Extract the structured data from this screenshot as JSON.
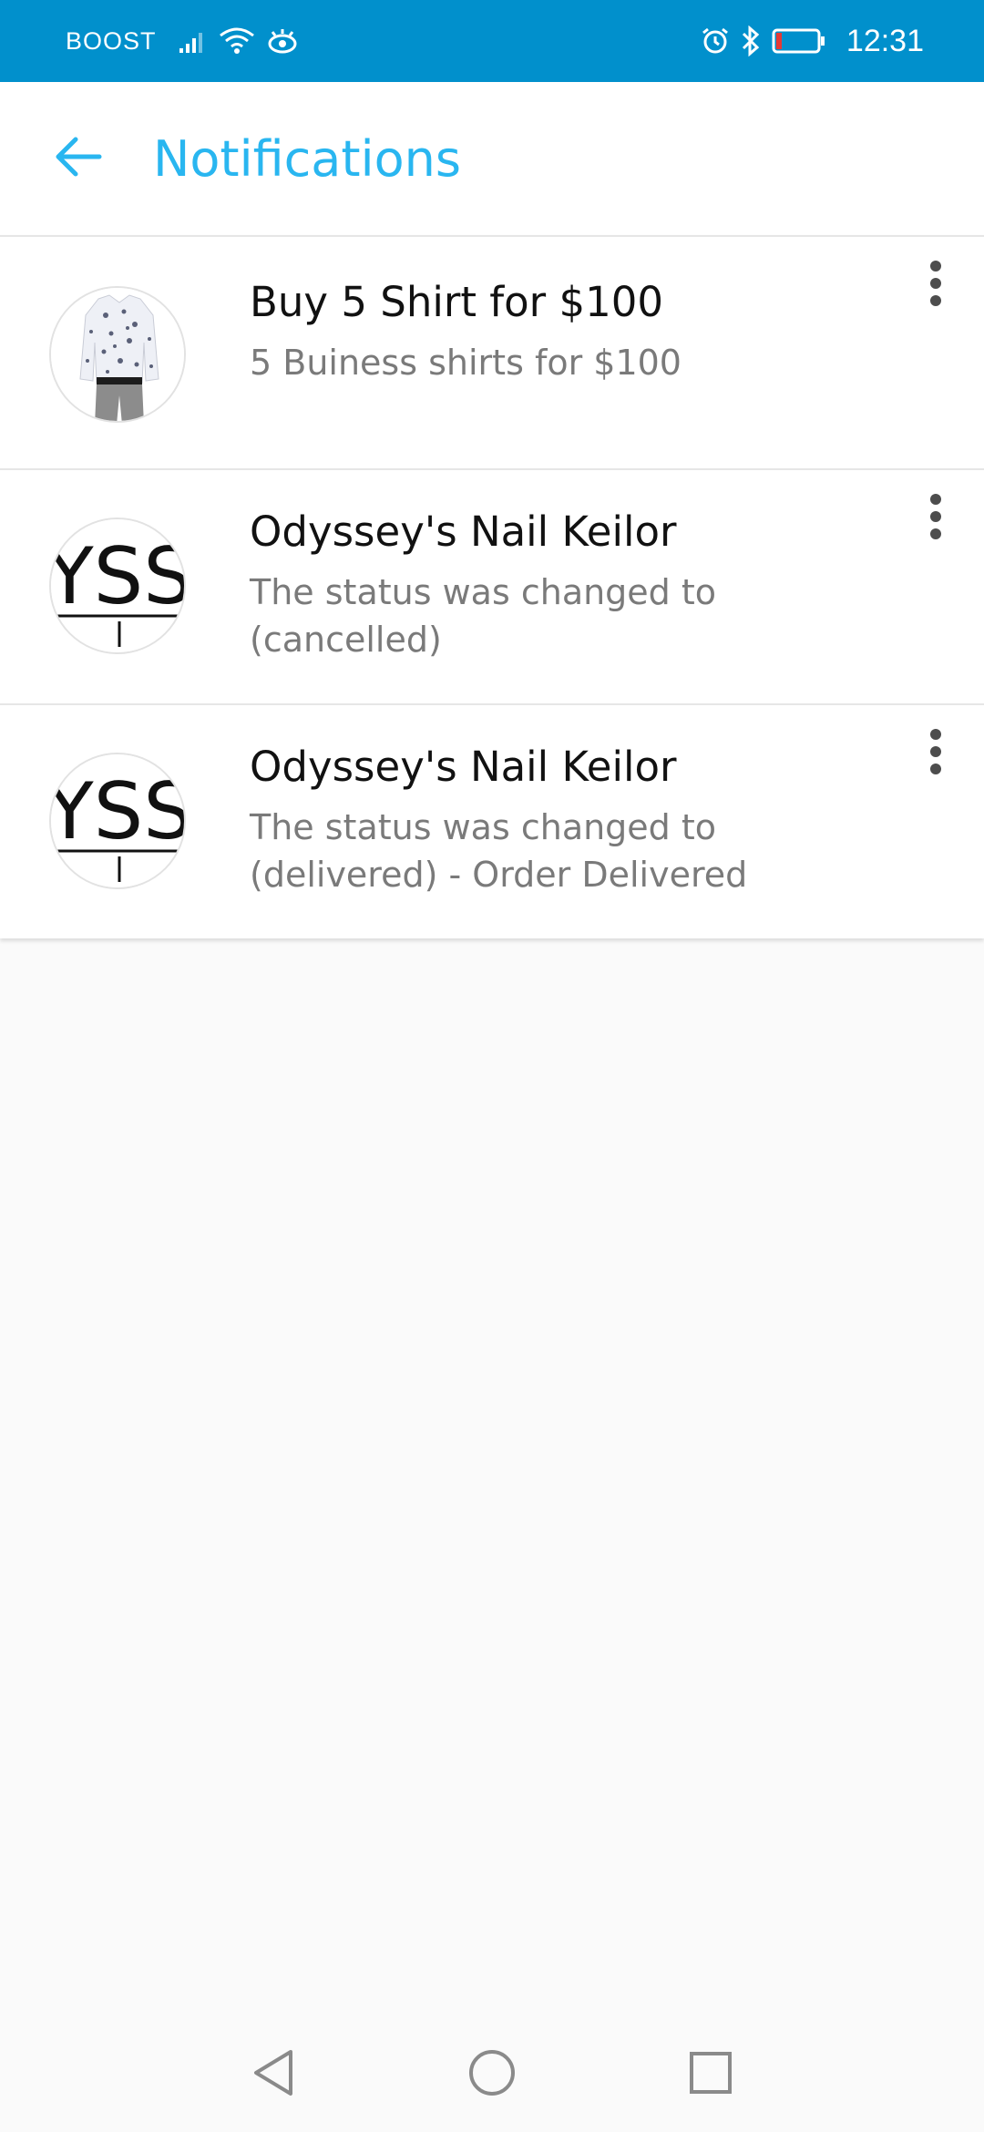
{
  "status_bar": {
    "carrier": "BOOST",
    "time": "12:31",
    "icons": [
      "signal-icon",
      "wifi-icon",
      "eye-icon",
      "alarm-icon",
      "bluetooth-icon",
      "battery-icon"
    ],
    "battery_level": 0.1
  },
  "header": {
    "title": "Notifications",
    "back_icon": "arrow-back-icon"
  },
  "notifications": [
    {
      "title": "Buy 5 Shirt for $100",
      "body": "5 Buiness shirts for $100",
      "avatar": "shirt-product-image"
    },
    {
      "title": "Odyssey's Nail Keilor",
      "body": "The status was changed to (cancelled)",
      "avatar": "store-logo-image"
    },
    {
      "title": "Odyssey's Nail Keilor",
      "body": "The status was changed to (delivered) - Order Delivered",
      "avatar": "store-logo-image"
    }
  ],
  "colors": {
    "status_bar": "#0190cc",
    "accent": "#29b6f0",
    "title_text": "#111111",
    "body_text": "#7a7a7a",
    "background": "#fafafa"
  },
  "nav_bar": {
    "icons": [
      "back-triangle-icon",
      "home-circle-icon",
      "recents-square-icon"
    ]
  }
}
